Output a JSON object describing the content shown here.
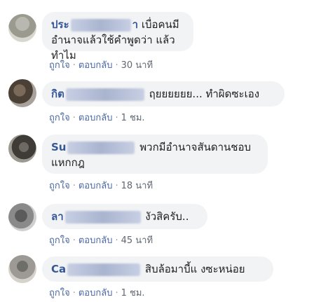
{
  "comments": [
    {
      "author_visible": "ประ",
      "author_suffix": "า",
      "text": "เบื่อคนมีอำนาจแล้วใช้คำพูดว่า แล้วทำไม",
      "like_label": "ถูกใจ",
      "reply_label": "ตอบกลับ",
      "time": "30 นาที"
    },
    {
      "author_visible": "กิต",
      "author_suffix": "",
      "text": "ฤยยยยยย... ทำผิดซะเอง",
      "like_label": "ถูกใจ",
      "reply_label": "ตอบกลับ",
      "time": "1 ชม."
    },
    {
      "author_visible": "Su",
      "author_suffix": "",
      "text": "พวกมีอำนาจสันดานชอบแหกกฎ",
      "like_label": "ถูกใจ",
      "reply_label": "ตอบกลับ",
      "time": "18 นาที"
    },
    {
      "author_visible": "ลา",
      "author_suffix": "",
      "text": "งัวสิครับ..",
      "like_label": "ถูกใจ",
      "reply_label": "ตอบกลับ",
      "time": "45 นาที"
    },
    {
      "author_visible": "Ca",
      "author_suffix": "",
      "text": "สิบล้อมาบี้แ งซะหน่อย",
      "like_label": "ถูกใจ",
      "reply_label": "ตอบกลับ",
      "time": "1 ชม."
    }
  ],
  "separator": "·"
}
